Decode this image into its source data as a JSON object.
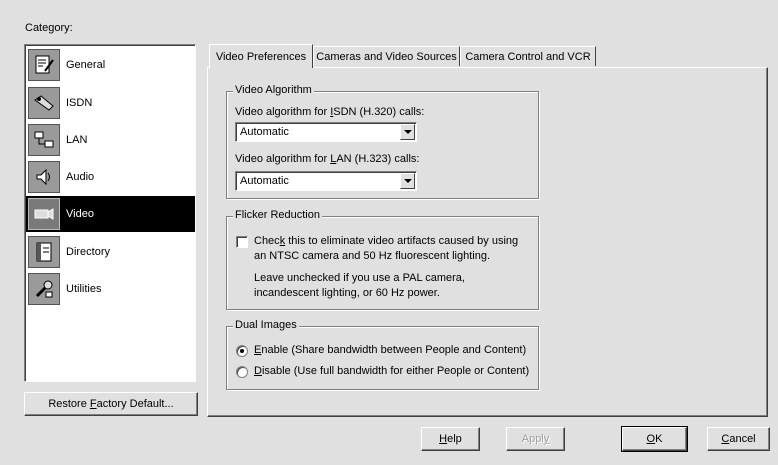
{
  "category_label": "Category:",
  "categories": [
    {
      "label": "General",
      "icon": "general-icon"
    },
    {
      "label": "ISDN",
      "icon": "isdn-icon"
    },
    {
      "label": "LAN",
      "icon": "lan-icon"
    },
    {
      "label": "Audio",
      "icon": "audio-icon"
    },
    {
      "label": "Video",
      "icon": "video-icon",
      "selected": true
    },
    {
      "label": "Directory",
      "icon": "directory-icon"
    },
    {
      "label": "Utilities",
      "icon": "utilities-icon"
    }
  ],
  "restore_button": {
    "pre": "Restore ",
    "mnemonic": "F",
    "post": "actory Default..."
  },
  "tabs": [
    {
      "label": "Video Preferences",
      "active": true
    },
    {
      "label": "Cameras and Video Sources"
    },
    {
      "label": "Camera Control and VCR"
    }
  ],
  "video_algorithm": {
    "title": "Video Algorithm",
    "isdn_label": {
      "pre": "Video algorithm for ",
      "mnemonic": "I",
      "post": "SDN (H.320) calls:"
    },
    "isdn_value": "Automatic",
    "lan_label": {
      "pre": "Video algorithm for ",
      "mnemonic": "L",
      "post": "AN (H.323) calls:"
    },
    "lan_value": "Automatic"
  },
  "flicker_reduction": {
    "title": "Flicker Reduction",
    "checkbox_line1": {
      "pre": "Chec",
      "mnemonic": "k",
      "post": " this to eliminate video artifacts caused by using"
    },
    "checkbox_line2": "an NTSC camera and 50 Hz fluorescent lighting.",
    "checked": false,
    "note_line1": "Leave unchecked if you use a PAL camera,",
    "note_line2": "incandescent lighting, or 60 Hz power."
  },
  "dual_images": {
    "title": "Dual Images",
    "enable": {
      "mnemonic": "E",
      "post": "nable (Share bandwidth between People and Content)",
      "selected": true
    },
    "disable": {
      "mnemonic": "D",
      "post": "isable (Use full bandwidth for either People or Content)",
      "selected": false
    }
  },
  "buttons": {
    "help": {
      "mnemonic": "H",
      "post": "elp"
    },
    "apply": {
      "pre": "Appl",
      "mnemonic": "y",
      "post": ""
    },
    "ok": {
      "mnemonic": "O",
      "post": "K"
    },
    "cancel": {
      "mnemonic": "C",
      "post": "ancel"
    }
  }
}
